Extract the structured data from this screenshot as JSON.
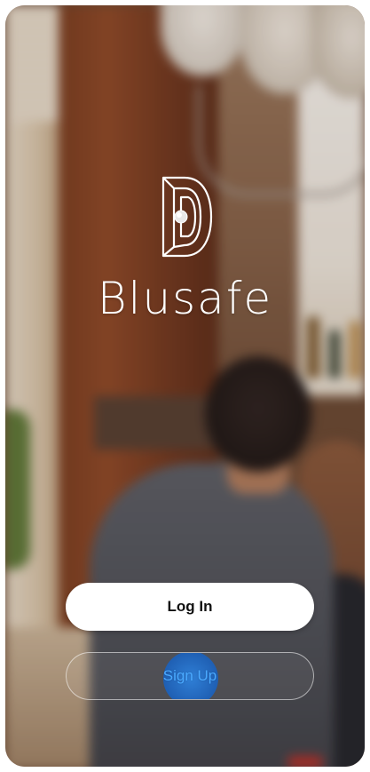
{
  "app": {
    "brand_name": "Blusafe",
    "logo_icon": "blusafe-logo-icon"
  },
  "actions": {
    "login_label": "Log In",
    "signup_label": "Sign Up"
  },
  "colors": {
    "login_bg": "#ffffff",
    "login_text": "#111111",
    "signup_text": "#4aa9ff",
    "touch_ripple": "#2f7fd6"
  }
}
